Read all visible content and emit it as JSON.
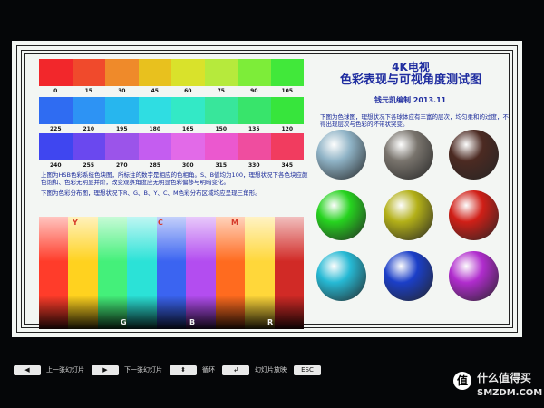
{
  "slide": {
    "title_line1": "4K电视",
    "title_line2": "色彩表现与可视角度测试图",
    "author_date": "钱元凯编制  2013.11",
    "note_sphere": "下图为色球图，理想状况下各球体应有丰富的层次，均匀柔和的过度，不得出现层次与色彩的坏带状突变。",
    "note_hue": "上图为HSB色彩系统色块图，所标注的数字是相应的色相角。S、B值均为100，理想状况下各色块应颜色饱和、色彩无明显并阶，改变观察角度应无明显色彩偏移与明暗变化。",
    "note_triangle": "下图为色彩分布图，理想状况下R、G、B、Y、C、M色彩分布区域均应呈现三角形。",
    "rows": [
      {
        "labels": [
          "0",
          "15",
          "30",
          "45",
          "60",
          "75",
          "90",
          "105"
        ],
        "colors": [
          "#f2272b",
          "#f04a2c",
          "#ef8a2a",
          "#e8c11e",
          "#d9e22b",
          "#b6ea3c",
          "#7ded39",
          "#41e83a"
        ]
      },
      {
        "labels": [
          "225",
          "210",
          "195",
          "180",
          "165",
          "150",
          "135",
          "120"
        ],
        "colors": [
          "#2f6cf2",
          "#2d93f4",
          "#27b6ee",
          "#2fdde2",
          "#33e9c6",
          "#38e69b",
          "#38e46b",
          "#37e53c"
        ]
      },
      {
        "labels": [
          "240",
          "255",
          "270",
          "285",
          "300",
          "315",
          "330",
          "345"
        ],
        "colors": [
          "#3f46f0",
          "#6a48ef",
          "#9b54ea",
          "#c45df0",
          "#e26ae8",
          "#eb58cf",
          "#ef4d9f",
          "#f13c5f"
        ]
      }
    ],
    "spectrum": {
      "top_labels": [
        "Y",
        "C",
        "M"
      ],
      "bottom_labels": [
        "G",
        "B",
        "R"
      ],
      "colors": [
        "#ff3c2a",
        "#ffd21f",
        "#44f07a",
        "#2be2d7",
        "#3b64f1",
        "#b34df0",
        "#ff6b1f",
        "#ffd73a",
        "#d12a26"
      ]
    },
    "spheres": [
      {
        "name": "light-gray-sphere",
        "color": "#8fb3c6"
      },
      {
        "name": "gray-sphere",
        "color": "#79746d"
      },
      {
        "name": "brown-sphere",
        "color": "#4c2a22"
      },
      {
        "name": "green-sphere",
        "color": "#26d31f"
      },
      {
        "name": "yellow-sphere",
        "color": "#b3b018"
      },
      {
        "name": "red-sphere",
        "color": "#d01f17"
      },
      {
        "name": "cyan-sphere",
        "color": "#26b9d4"
      },
      {
        "name": "blue-sphere",
        "color": "#1b3fc8"
      },
      {
        "name": "purple-sphere",
        "color": "#b02ccd"
      }
    ]
  },
  "taskbar": {
    "prev": {
      "key": "◀",
      "label": "上一张幻灯片"
    },
    "next": {
      "key": "▶",
      "label": "下一张幻灯片"
    },
    "loop": {
      "key": "⬍",
      "label": "循环"
    },
    "slideshow": {
      "key": "↲",
      "label": "幻灯片放映"
    },
    "esc": {
      "key": "ESC"
    }
  },
  "watermark": {
    "badge": "值",
    "brand": "什么值得买",
    "url": "SMZDM.COM"
  }
}
